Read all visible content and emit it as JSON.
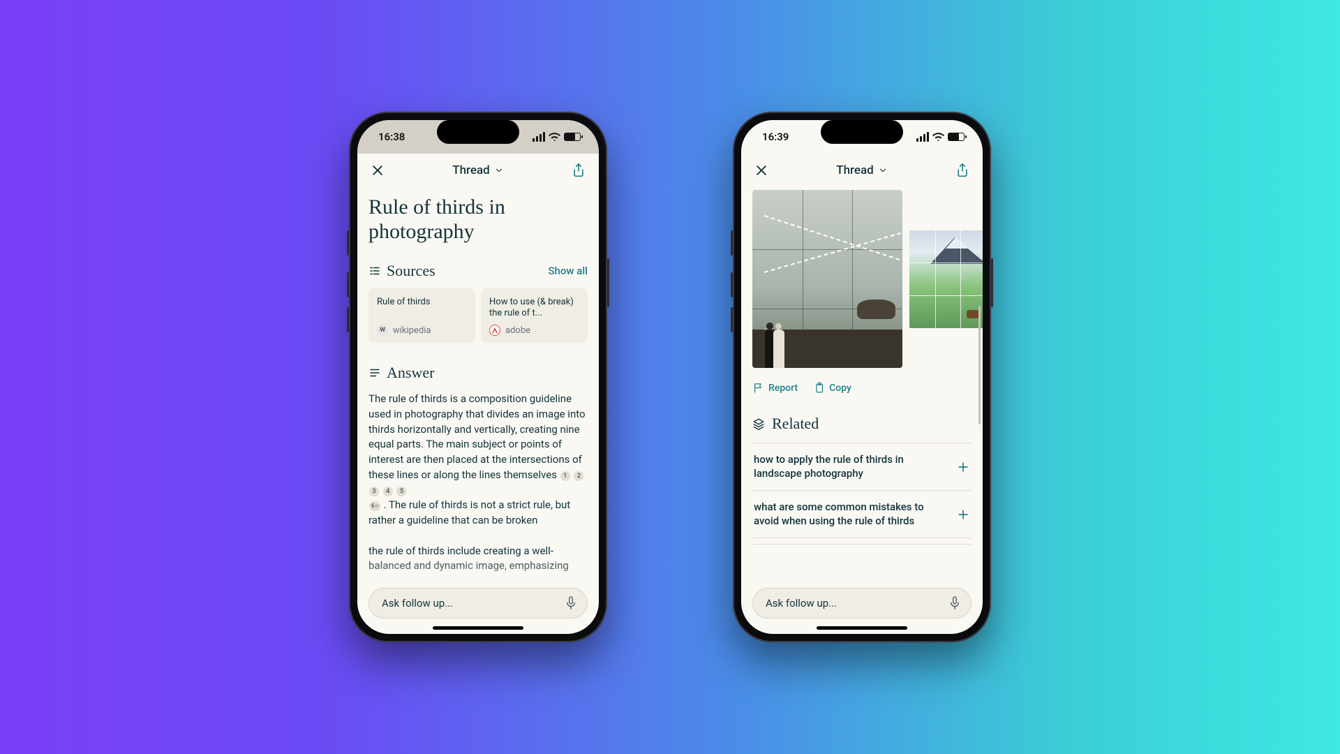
{
  "phones": {
    "left": {
      "status": {
        "time": "16:38"
      },
      "nav": {
        "title": "Thread"
      },
      "title": "Rule of thirds in photography",
      "sources": {
        "label": "Sources",
        "show_all": "Show all",
        "cards": [
          {
            "title": "Rule of thirds",
            "site": "wikipedia"
          },
          {
            "title": "How to use (& break) the rule of t...",
            "site": "adobe"
          }
        ]
      },
      "answer": {
        "label": "Answer",
        "p1a": "The rule of thirds is a composition guideline used in photography that divides an image into thirds horizontally and vertically, creating nine equal parts. The main subject or points of interest are then placed at the intersections of these lines or along the lines themselves ",
        "cites": [
          "1",
          "2",
          "3",
          "4",
          "5"
        ],
        "p1b": ". The rule of thirds is not a strict rule, but rather a guideline that can be broken",
        "cite6": "6",
        "p1c": "the rule of thirds include creating a well-balanced and dynamic image, emphasizing"
      },
      "ask": {
        "placeholder": "Ask follow up..."
      }
    },
    "right": {
      "status": {
        "time": "16:39"
      },
      "nav": {
        "title": "Thread"
      },
      "actions": {
        "report": "Report",
        "copy": "Copy"
      },
      "related": {
        "label": "Related",
        "items": [
          "how to apply the rule of thirds in landscape photography",
          "what are some common mistakes to avoid when using the rule of thirds"
        ]
      },
      "ask": {
        "placeholder": "Ask follow up..."
      }
    }
  }
}
